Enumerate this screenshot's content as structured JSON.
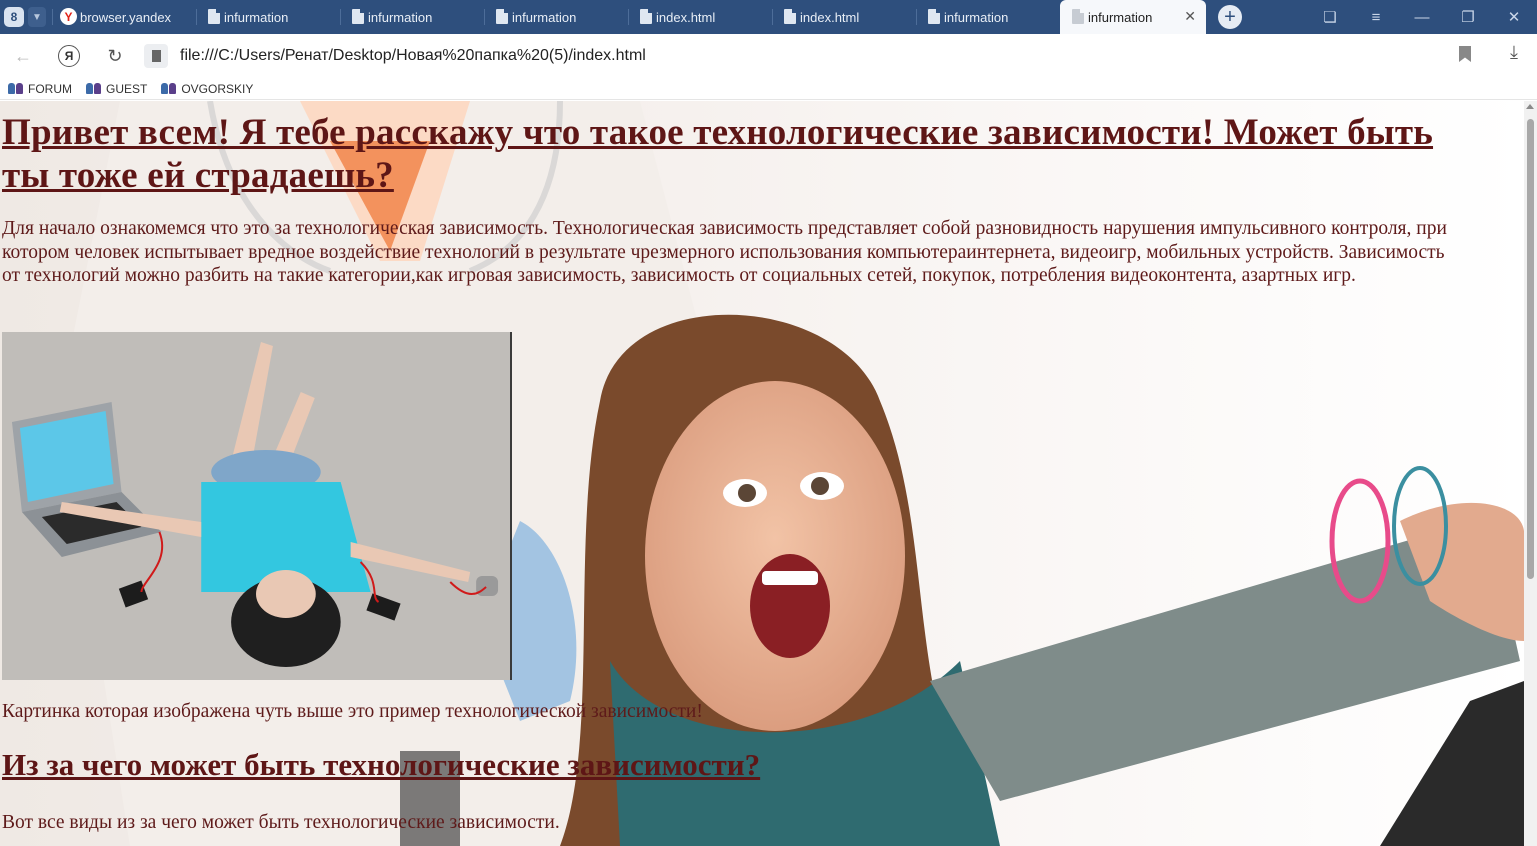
{
  "browser": {
    "tab_count": "8",
    "tabs": [
      {
        "label": "browser.yandex",
        "kind": "yandex"
      },
      {
        "label": "infurmation",
        "kind": "file"
      },
      {
        "label": "infurmation",
        "kind": "file"
      },
      {
        "label": "infurmation",
        "kind": "file"
      },
      {
        "label": "index.html",
        "kind": "file"
      },
      {
        "label": "index.html",
        "kind": "file"
      },
      {
        "label": "infurmation",
        "kind": "file"
      },
      {
        "label": "infurmation",
        "kind": "file",
        "active": true
      }
    ],
    "address": "file:///C:/Users/Ренат/Desktop/Новая%20папка%20(5)/index.html",
    "bookmarks": [
      "FORUM",
      "GUEST",
      "OVGORSKIY"
    ]
  },
  "page": {
    "heading": "Привет всем! Я тебе расскажу что такое технологические зависимости! Может быть ты тоже ей страдаешь?",
    "intro": "Для начало ознакомемся что это за технологическая зависимость. Технологическая зависимость представляет собой разновидность нарушения импульсивного контроля, при котором человек испытывает вредное воздействие технологий в результате чрезмерного использования компьютераинтернета, видеоигр, мобильных устройств. Зависимость от технологий можно разбить на такие категории,как игровая зависимость, зависимость от социальных сетей, покупок, потребления видеоконтента, азартных игр.",
    "caption": "Картинка которая изображена чуть выше это пример технологической зависимости!",
    "subheading": "Из за чего может быть технологические зависимости?",
    "paragraph2": "Вот все виды из за чего может быть технологические зависимости."
  },
  "colors": {
    "tabbar": "#2e4f7d",
    "text": "#5e1616"
  }
}
